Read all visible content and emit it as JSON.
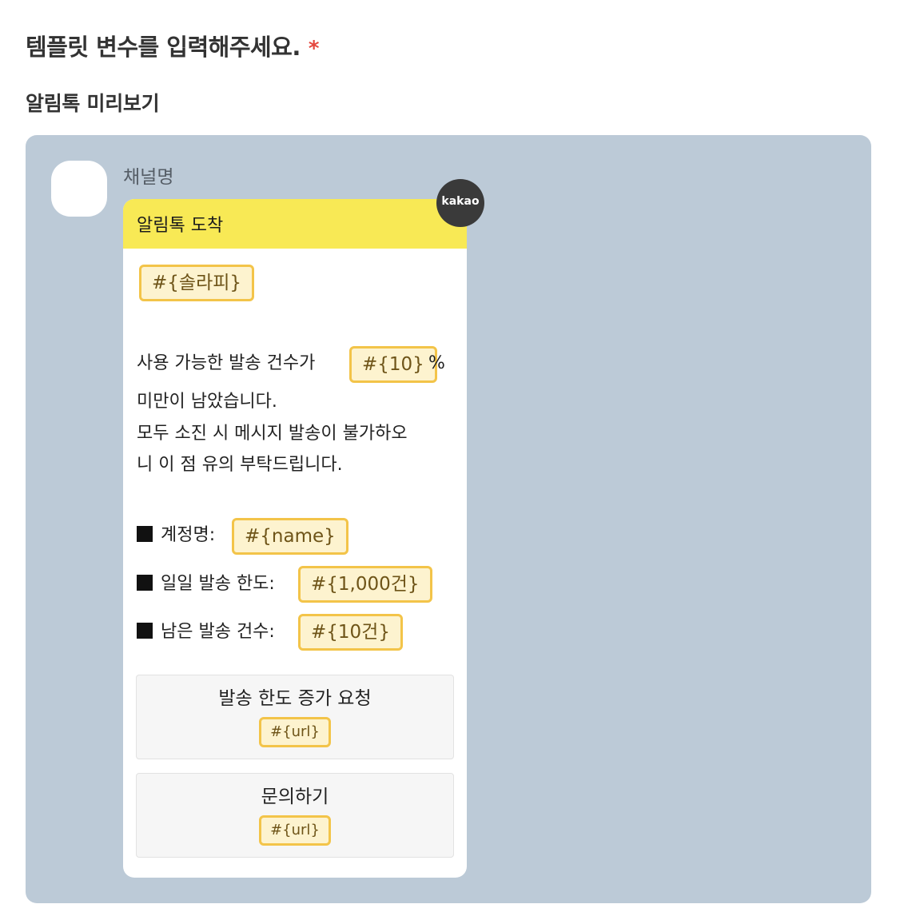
{
  "page": {
    "section_title": "템플릿 변수를 입력해주세요.",
    "required_mark": "*",
    "preview_title": "알림톡 미리보기"
  },
  "preview": {
    "channel_name": "채널명",
    "badge": "kakao",
    "header_title": "알림톡 도착",
    "header_color": "#f8e955",
    "panel_color": "#bccad7",
    "chip_border_color": "#f3c449",
    "chip_fill_color": "#fdf3cf",
    "variables": {
      "sender": "#{솔라피}",
      "percent": "#{10}",
      "name": "#{name}",
      "daily_limit": "#{1,000건}",
      "remaining": "#{10건}"
    },
    "body": {
      "line1_prefix": "사용 가능한 발송 건수가",
      "line1_suffix": "%",
      "line2": "미만이 남았습니다.",
      "line3": "모두 소진 시 메시지 발송이 불가하오",
      "line4": "니 이 점 유의 부탁드립니다.",
      "account_label": "계정명:",
      "daily_limit_label": "일일 발송 한도:",
      "remaining_label": "남은 발송 건수:"
    },
    "buttons": [
      {
        "label": "발송 한도 증가 요청",
        "url_var": "#{url}"
      },
      {
        "label": "문의하기",
        "url_var": "#{url}"
      }
    ]
  }
}
